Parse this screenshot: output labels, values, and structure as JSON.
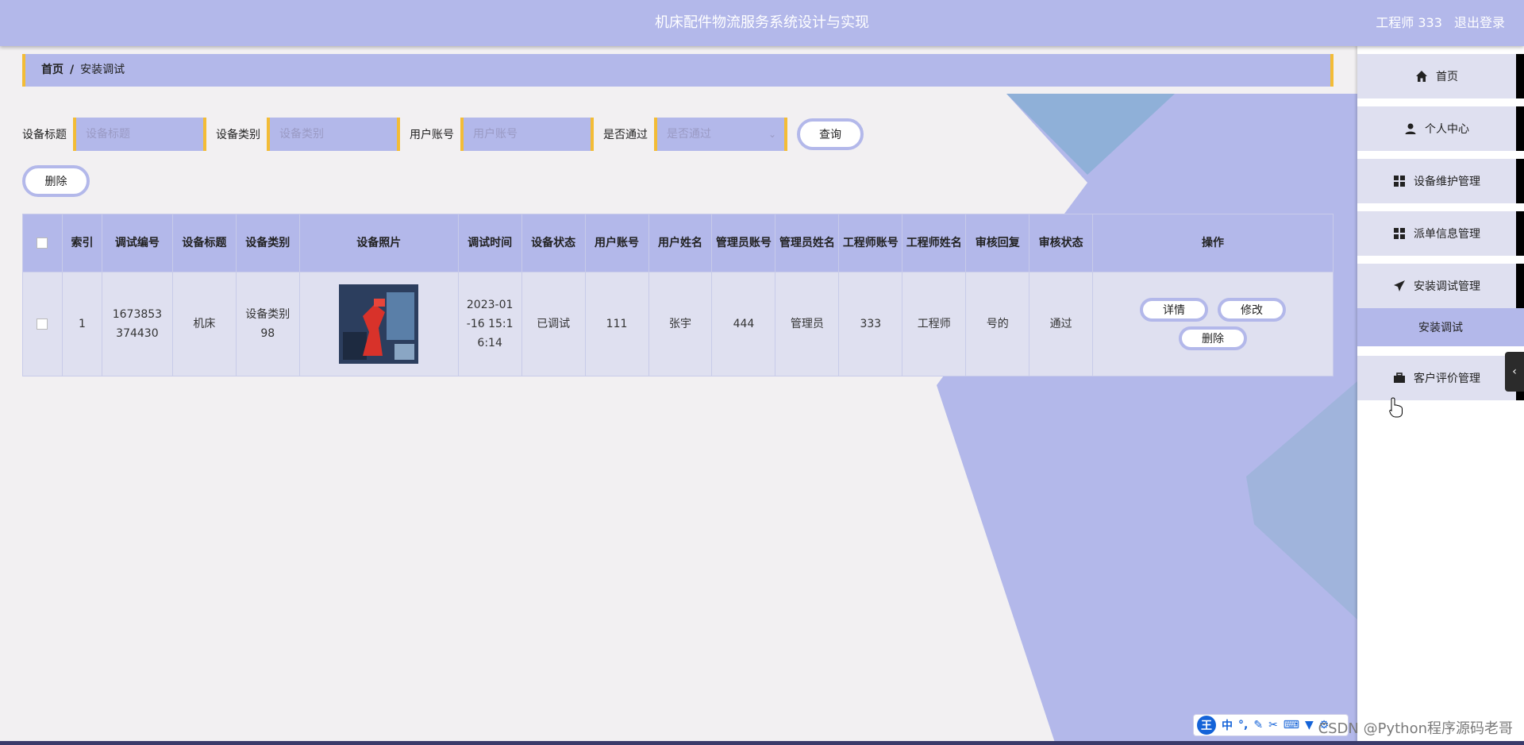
{
  "header": {
    "title": "机床配件物流服务系统设计与实现",
    "user_label": "工程师 333",
    "logout_label": "退出登录"
  },
  "breadcrumb": {
    "home": "首页",
    "separator": "/",
    "current": "安装调试"
  },
  "search": {
    "fields": [
      {
        "label": "设备标题",
        "placeholder": "设备标题"
      },
      {
        "label": "设备类别",
        "placeholder": "设备类别"
      },
      {
        "label": "用户账号",
        "placeholder": "用户账号"
      },
      {
        "label": "是否通过",
        "placeholder": "是否通过"
      }
    ],
    "query_label": "查询"
  },
  "actions": {
    "delete_label": "删除"
  },
  "table": {
    "headers": [
      "索引",
      "调试编号",
      "设备标题",
      "设备类别",
      "设备照片",
      "调试时间",
      "设备状态",
      "用户账号",
      "用户姓名",
      "管理员账号",
      "管理员姓名",
      "工程师账号",
      "工程师姓名",
      "审核回复",
      "审核状态",
      "操作"
    ],
    "rows": [
      {
        "index": "1",
        "debug_no": "1673853374430",
        "title": "机床",
        "category": "设备类别98",
        "time": "2023-01-16 15:16:14",
        "status": "已调试",
        "user_account": "111",
        "user_name": "张宇",
        "admin_account": "444",
        "admin_name": "管理员",
        "engineer_account": "333",
        "engineer_name": "工程师",
        "review_reply": "号的",
        "review_status": "通过",
        "ops": {
          "detail": "详情",
          "edit": "修改",
          "delete": "删除"
        }
      }
    ]
  },
  "sidebar": {
    "items": [
      {
        "label": "首页",
        "icon": "home-icon"
      },
      {
        "label": "个人中心",
        "icon": "person-icon"
      },
      {
        "label": "设备维护管理",
        "icon": "grid-icon"
      },
      {
        "label": "派单信息管理",
        "icon": "grid-icon"
      },
      {
        "label": "安装调试管理",
        "icon": "send-icon"
      },
      {
        "label": "客户评价管理",
        "icon": "briefcase-icon"
      }
    ],
    "active_sub": "安装调试"
  },
  "ime": {
    "lang": "中"
  },
  "watermark": "CSDN @Python程序源码老哥",
  "colors": {
    "accent": "#b3b8ea",
    "border_accent": "#f3bc36",
    "row_bg": "#dfe0f0"
  }
}
